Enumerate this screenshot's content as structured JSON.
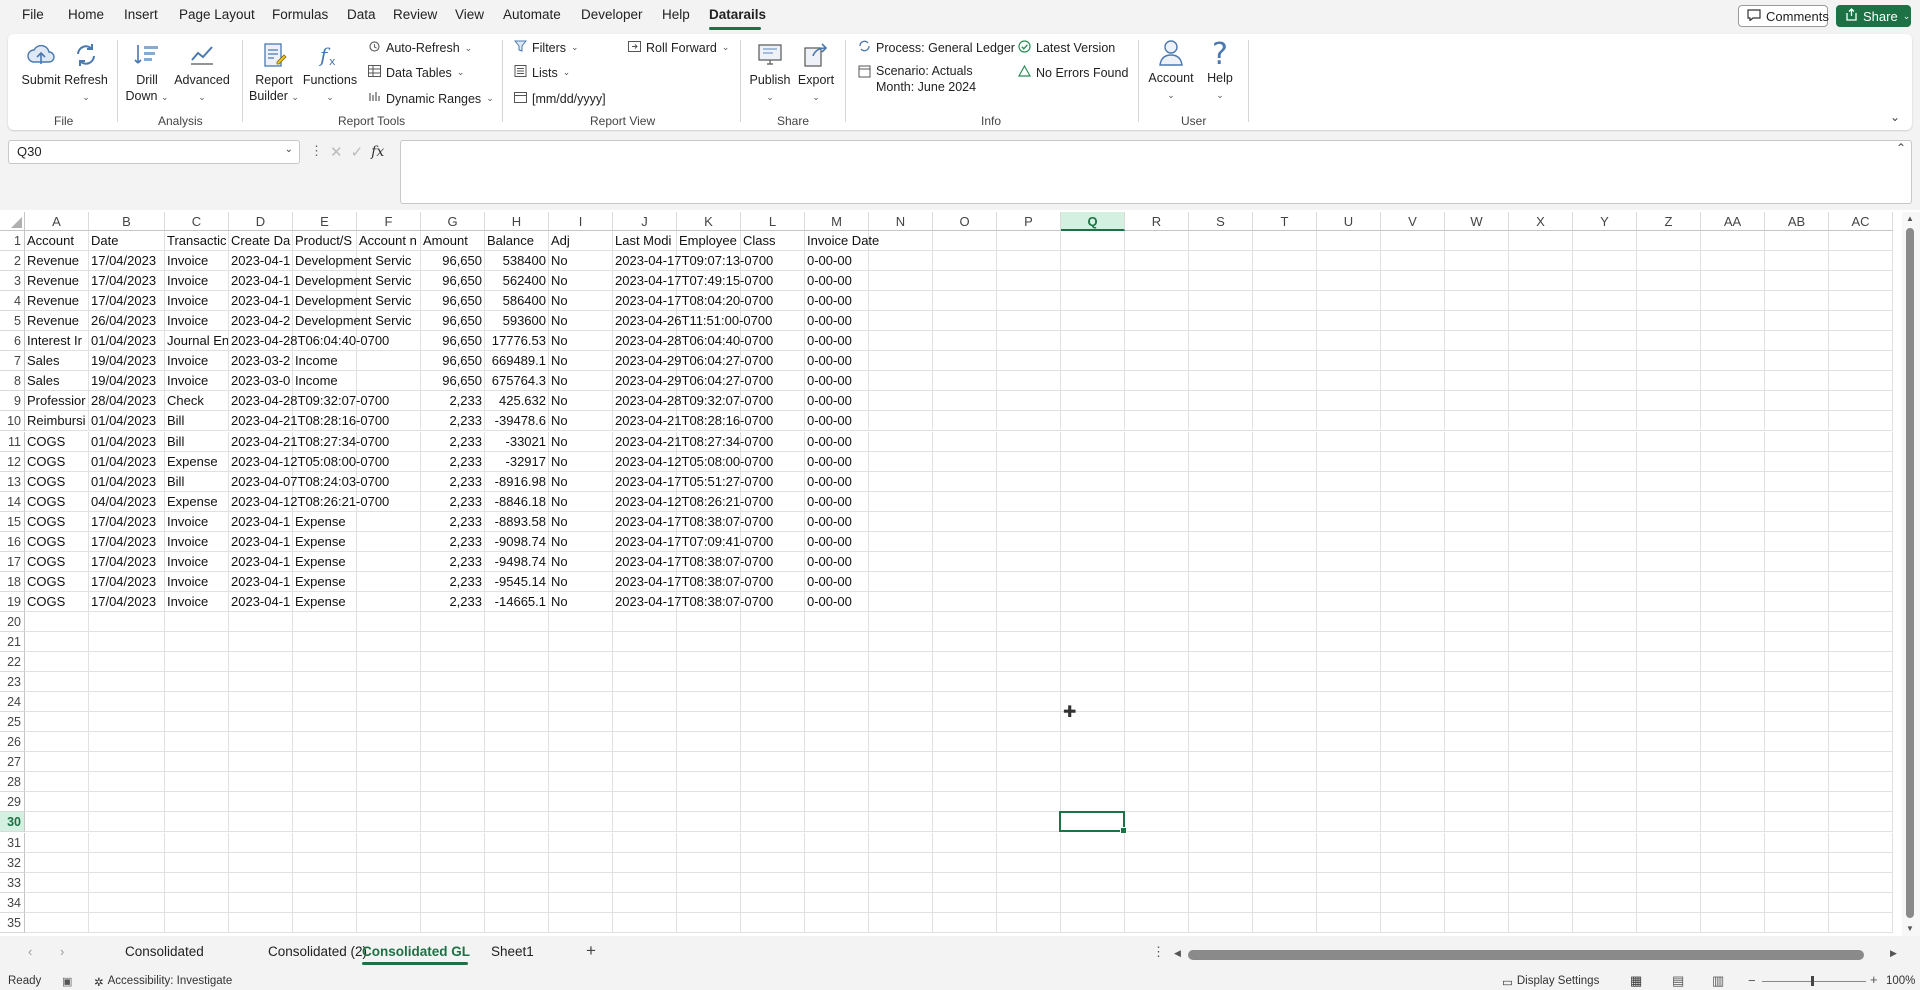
{
  "menu": {
    "tabs": [
      "File",
      "Home",
      "Insert",
      "Page Layout",
      "Formulas",
      "Data",
      "Review",
      "View",
      "Automate",
      "Developer",
      "Help",
      "Datarails"
    ],
    "active_tab": "Datarails",
    "comments_label": "Comments",
    "share_label": "Share"
  },
  "ribbon": {
    "file_group": {
      "submit": "Submit",
      "refresh": "Refresh",
      "label": "File"
    },
    "analysis_group": {
      "drill_down_line1": "Drill",
      "drill_down_line2": "Down",
      "advanced": "Advanced",
      "label": "Analysis"
    },
    "report_tools_group": {
      "report_builder_line1": "Report",
      "report_builder_line2": "Builder",
      "functions": "Functions",
      "auto_refresh": "Auto-Refresh",
      "data_tables": "Data Tables",
      "dynamic_ranges": "Dynamic Ranges",
      "label": "Report Tools"
    },
    "report_view_group": {
      "filters": "Filters",
      "lists": "Lists",
      "date_format": "[mm/dd/yyyy]",
      "roll_forward": "Roll Forward",
      "label": "Report View"
    },
    "share_group": {
      "publish": "Publish",
      "export": "Export",
      "label": "Share"
    },
    "info_group": {
      "process": "Process: General Ledger",
      "scenario": "Scenario: Actuals",
      "month": "Month: June 2024",
      "latest_version": "Latest Version",
      "no_errors": "No Errors Found",
      "label": "Info"
    },
    "user_group": {
      "account": "Account",
      "help": "Help",
      "label": "User"
    }
  },
  "formula_bar": {
    "name_box": "Q30",
    "formula": ""
  },
  "grid": {
    "columns": [
      "A",
      "B",
      "C",
      "D",
      "E",
      "F",
      "G",
      "H",
      "I",
      "J",
      "K",
      "L",
      "M",
      "N",
      "O",
      "P",
      "Q",
      "R",
      "S",
      "T",
      "U",
      "V",
      "W",
      "X",
      "Y",
      "Z",
      "AA",
      "AB",
      "AC"
    ],
    "selected_column": "Q",
    "row_numbers": [
      "1",
      "2",
      "3",
      "4",
      "5",
      "6",
      "7",
      "8",
      "9",
      "10",
      "11",
      "12",
      "13",
      "14",
      "15",
      "16",
      "17",
      "18",
      "19",
      "20",
      "21",
      "22",
      "23",
      "24",
      "25",
      "26",
      "27",
      "28",
      "29",
      "30",
      "31",
      "32",
      "33",
      "34",
      "35"
    ],
    "selected_row": "30",
    "rows": [
      [
        "Account",
        "Date",
        "Transactic",
        "Create Da",
        "Product/S",
        "Account n",
        "Amount",
        "Balance",
        "Adj",
        "Last Modi",
        "Employee",
        "Class",
        "Invoice Date"
      ],
      [
        "Revenue",
        "17/04/2023",
        "Invoice",
        "2023-04-1",
        "Development Servic",
        "",
        "96,650",
        "538400",
        "No",
        "2023-04-17T09:07:13-0700",
        "",
        "",
        "0-00-00"
      ],
      [
        "Revenue",
        "17/04/2023",
        "Invoice",
        "2023-04-1",
        "Development Servic",
        "",
        "96,650",
        "562400",
        "No",
        "2023-04-17T07:49:15-0700",
        "",
        "",
        "0-00-00"
      ],
      [
        "Revenue",
        "17/04/2023",
        "Invoice",
        "2023-04-1",
        "Development Servic",
        "",
        "96,650",
        "586400",
        "No",
        "2023-04-17T08:04:20-0700",
        "",
        "",
        "0-00-00"
      ],
      [
        "Revenue",
        "26/04/2023",
        "Invoice",
        "2023-04-2",
        "Development Servic",
        "",
        "96,650",
        "593600",
        "No",
        "2023-04-26T11:51:00-0700",
        "",
        "",
        "0-00-00"
      ],
      [
        "Interest Ir",
        "01/04/2023",
        "Journal En",
        "2023-04-28T06:04:40-0700",
        "",
        "",
        "96,650",
        "17776.53",
        "No",
        "2023-04-28T06:04:40-0700",
        "",
        "",
        "0-00-00"
      ],
      [
        "Sales",
        "19/04/2023",
        "Invoice",
        "2023-03-2",
        "Income",
        "",
        "96,650",
        "669489.1",
        "No",
        "2023-04-29T06:04:27-0700",
        "",
        "",
        "0-00-00"
      ],
      [
        "Sales",
        "19/04/2023",
        "Invoice",
        "2023-03-0",
        "Income",
        "",
        "96,650",
        "675764.3",
        "No",
        "2023-04-29T06:04:27-0700",
        "",
        "",
        "0-00-00"
      ],
      [
        "Professior",
        "28/04/2023",
        "Check",
        "2023-04-28T09:32:07-0700",
        "",
        "",
        "2,233",
        "425.632",
        "No",
        "2023-04-28T09:32:07-0700",
        "",
        "",
        "0-00-00"
      ],
      [
        "Reimbursi",
        "01/04/2023",
        "Bill",
        "2023-04-21T08:28:16-0700",
        "",
        "",
        "2,233",
        "-39478.6",
        "No",
        "2023-04-21T08:28:16-0700",
        "",
        "",
        "0-00-00"
      ],
      [
        "COGS",
        "01/04/2023",
        "Bill",
        "2023-04-21T08:27:34-0700",
        "",
        "",
        "2,233",
        "-33021",
        "No",
        "2023-04-21T08:27:34-0700",
        "",
        "",
        "0-00-00"
      ],
      [
        "COGS",
        "01/04/2023",
        "Expense",
        "2023-04-12T05:08:00-0700",
        "",
        "",
        "2,233",
        "-32917",
        "No",
        "2023-04-12T05:08:00-0700",
        "",
        "",
        "0-00-00"
      ],
      [
        "COGS",
        "01/04/2023",
        "Bill",
        "2023-04-07T08:24:03-0700",
        "",
        "",
        "2,233",
        "-8916.98",
        "No",
        "2023-04-17T05:51:27-0700",
        "",
        "",
        "0-00-00"
      ],
      [
        "COGS",
        "04/04/2023",
        "Expense",
        "2023-04-12T08:26:21-0700",
        "",
        "",
        "2,233",
        "-8846.18",
        "No",
        "2023-04-12T08:26:21-0700",
        "",
        "",
        "0-00-00"
      ],
      [
        "COGS",
        "17/04/2023",
        "Invoice",
        "2023-04-1",
        "Expense",
        "",
        "2,233",
        "-8893.58",
        "No",
        "2023-04-17T08:38:07-0700",
        "",
        "",
        "0-00-00"
      ],
      [
        "COGS",
        "17/04/2023",
        "Invoice",
        "2023-04-1",
        "Expense",
        "",
        "2,233",
        "-9098.74",
        "No",
        "2023-04-17T07:09:41-0700",
        "",
        "",
        "0-00-00"
      ],
      [
        "COGS",
        "17/04/2023",
        "Invoice",
        "2023-04-1",
        "Expense",
        "",
        "2,233",
        "-9498.74",
        "No",
        "2023-04-17T08:38:07-0700",
        "",
        "",
        "0-00-00"
      ],
      [
        "COGS",
        "17/04/2023",
        "Invoice",
        "2023-04-1",
        "Expense",
        "",
        "2,233",
        "-9545.14",
        "No",
        "2023-04-17T08:38:07-0700",
        "",
        "",
        "0-00-00"
      ],
      [
        "COGS",
        "17/04/2023",
        "Invoice",
        "2023-04-1",
        "Expense",
        "",
        "2,233",
        "-14665.1",
        "No",
        "2023-04-17T08:38:07-0700",
        "",
        "",
        "0-00-00"
      ]
    ]
  },
  "sheet_tabs": [
    "Consolidated",
    "Consolidated (2)",
    "Consolidated GL",
    "Sheet1"
  ],
  "active_sheet": "Consolidated GL",
  "status": {
    "ready": "Ready",
    "accessibility": "Accessibility: Investigate",
    "display_settings": "Display Settings",
    "zoom": "100%"
  }
}
